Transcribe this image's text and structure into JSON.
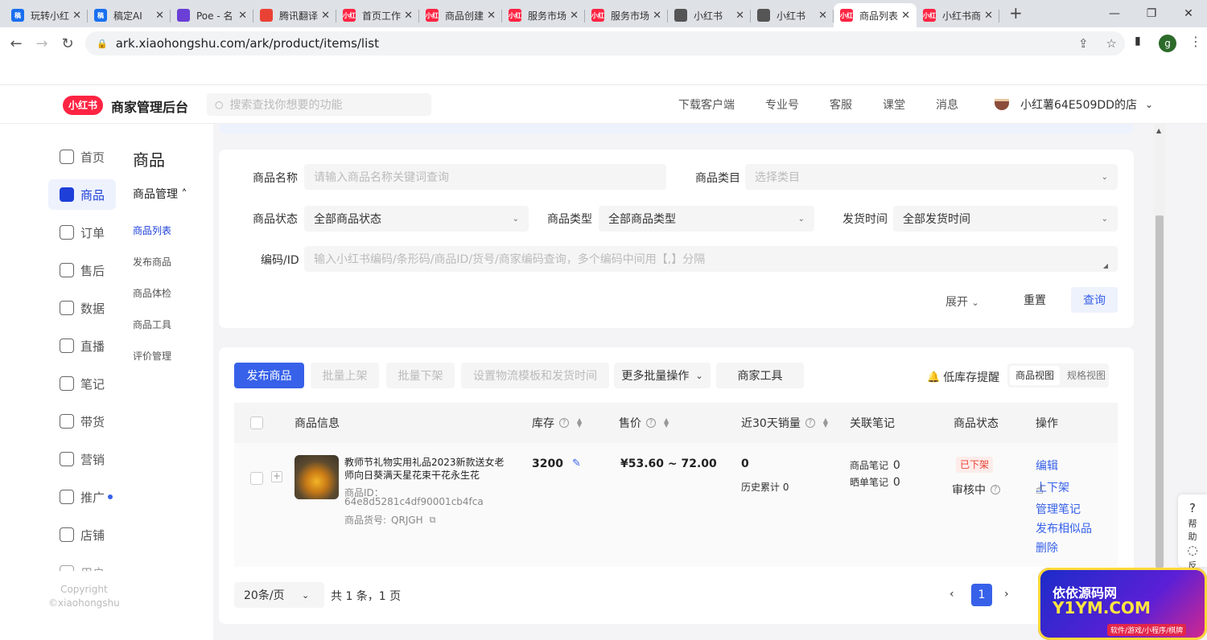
{
  "browser": {
    "tabs": [
      {
        "label": "玩转小红",
        "fav": "#1a6ff0",
        "glyph": "稿"
      },
      {
        "label": "稿定AI",
        "fav": "#1a6ff0",
        "glyph": "稿"
      },
      {
        "label": "Poe - 名",
        "fav": "#6b3fd6",
        "glyph": ""
      },
      {
        "label": "腾讯翻译",
        "fav": "#e94235",
        "glyph": ""
      },
      {
        "label": "首页工作",
        "fav": "#ff2442",
        "glyph": "小红"
      },
      {
        "label": "商品创建",
        "fav": "#ff2442",
        "glyph": "小红"
      },
      {
        "label": "服务市场",
        "fav": "#ff2442",
        "glyph": "小红"
      },
      {
        "label": "服务市场",
        "fav": "#ff2442",
        "glyph": "小红"
      },
      {
        "label": "小红书",
        "fav": "#555555",
        "glyph": ""
      },
      {
        "label": "小红书",
        "fav": "#555555",
        "glyph": ""
      },
      {
        "label": "商品列表",
        "fav": "#ff2442",
        "glyph": "小红",
        "active": true
      },
      {
        "label": "小红书商",
        "fav": "#ff2442",
        "glyph": "小红"
      }
    ],
    "url": "ark.xiaohongshu.com/ark/product/items/list",
    "profile_initial": "g"
  },
  "header": {
    "logo": "小红书",
    "brand": "商家管理后台",
    "search_placeholder": "搜索查找你想要的功能",
    "links": [
      "下载客户端",
      "专业号",
      "客服",
      "课堂",
      "消息"
    ],
    "shop_name": "小红薯64E509DD的店"
  },
  "sidebar": {
    "items": [
      "首页",
      "商品",
      "订单",
      "售后",
      "数据",
      "直播",
      "笔记",
      "带货",
      "营销",
      "推广",
      "店铺",
      "用户"
    ],
    "active_index": 1,
    "copyright_1": "Copyright",
    "copyright_2": "©xiaohongshu"
  },
  "subnav": {
    "title": "商品",
    "group": "商品管理 ˄",
    "items": [
      "商品列表",
      "发布商品",
      "商品体检",
      "商品工具",
      "评价管理"
    ],
    "active_index": 0
  },
  "filters": {
    "name_label": "商品名称",
    "name_placeholder": "请输入商品名称关键词查询",
    "category_label": "商品类目",
    "category_placeholder": "选择类目",
    "status_label": "商品状态",
    "status_value": "全部商品状态",
    "type_label": "商品类型",
    "type_value": "全部商品类型",
    "ship_label": "发货时间",
    "ship_value": "全部发货时间",
    "code_label": "编码/ID",
    "code_placeholder": "输入小红书编码/条形码/商品ID/货号/商家编码查询，多个编码中间用【,】分隔",
    "expand": "展开",
    "reset": "重置",
    "query": "查询"
  },
  "toolbar": {
    "publish": "发布商品",
    "batch_up": "批量上架",
    "batch_down": "批量下架",
    "logistics": "设置物流模板和发货时间",
    "more": "更多批量操作",
    "merchant_tools": "商家工具",
    "low_stock": "低库存提醒",
    "view_product": "商品视图",
    "view_spec": "规格视图"
  },
  "table": {
    "headers": {
      "info": "商品信息",
      "stock": "库存",
      "price": "售价",
      "sales30": "近30天销量",
      "notes": "关联笔记",
      "status": "商品状态",
      "ops": "操作"
    },
    "rows": [
      {
        "title": "教师节礼物实用礼品2023新款送女老师向日葵满天星花束干花永生花",
        "id_label": "商品ID：",
        "id_value": "64e8d5281c4df90001cb4fca",
        "sku_label": "商品货号:",
        "sku_value": "QRJGH",
        "stock": "3200",
        "price": "¥53.60 ~ 72.00",
        "sales30": "0",
        "sales_total": "历史累计 0",
        "note_label": "商品笔记",
        "note_value": "0",
        "share_label": "晒单笔记",
        "share_value": "0",
        "status_badge": "已下架",
        "review": "审核中",
        "ops": [
          "编辑",
          "上下架",
          "管理笔记",
          "发布相似品",
          "删除"
        ]
      }
    ]
  },
  "pagination": {
    "page_size": "20条/页",
    "summary": "共 1 条，1 页",
    "current": "1"
  },
  "float": {
    "help": "帮助",
    "feedback": "反馈"
  },
  "watermark": {
    "line1": "依依源码网",
    "line2": "Y1YM.COM",
    "line3": "软件/游戏/小程序/棋牌"
  },
  "colors": {
    "accent": "#3761e9",
    "brand": "#ff2442",
    "status_off": "#e94235"
  }
}
